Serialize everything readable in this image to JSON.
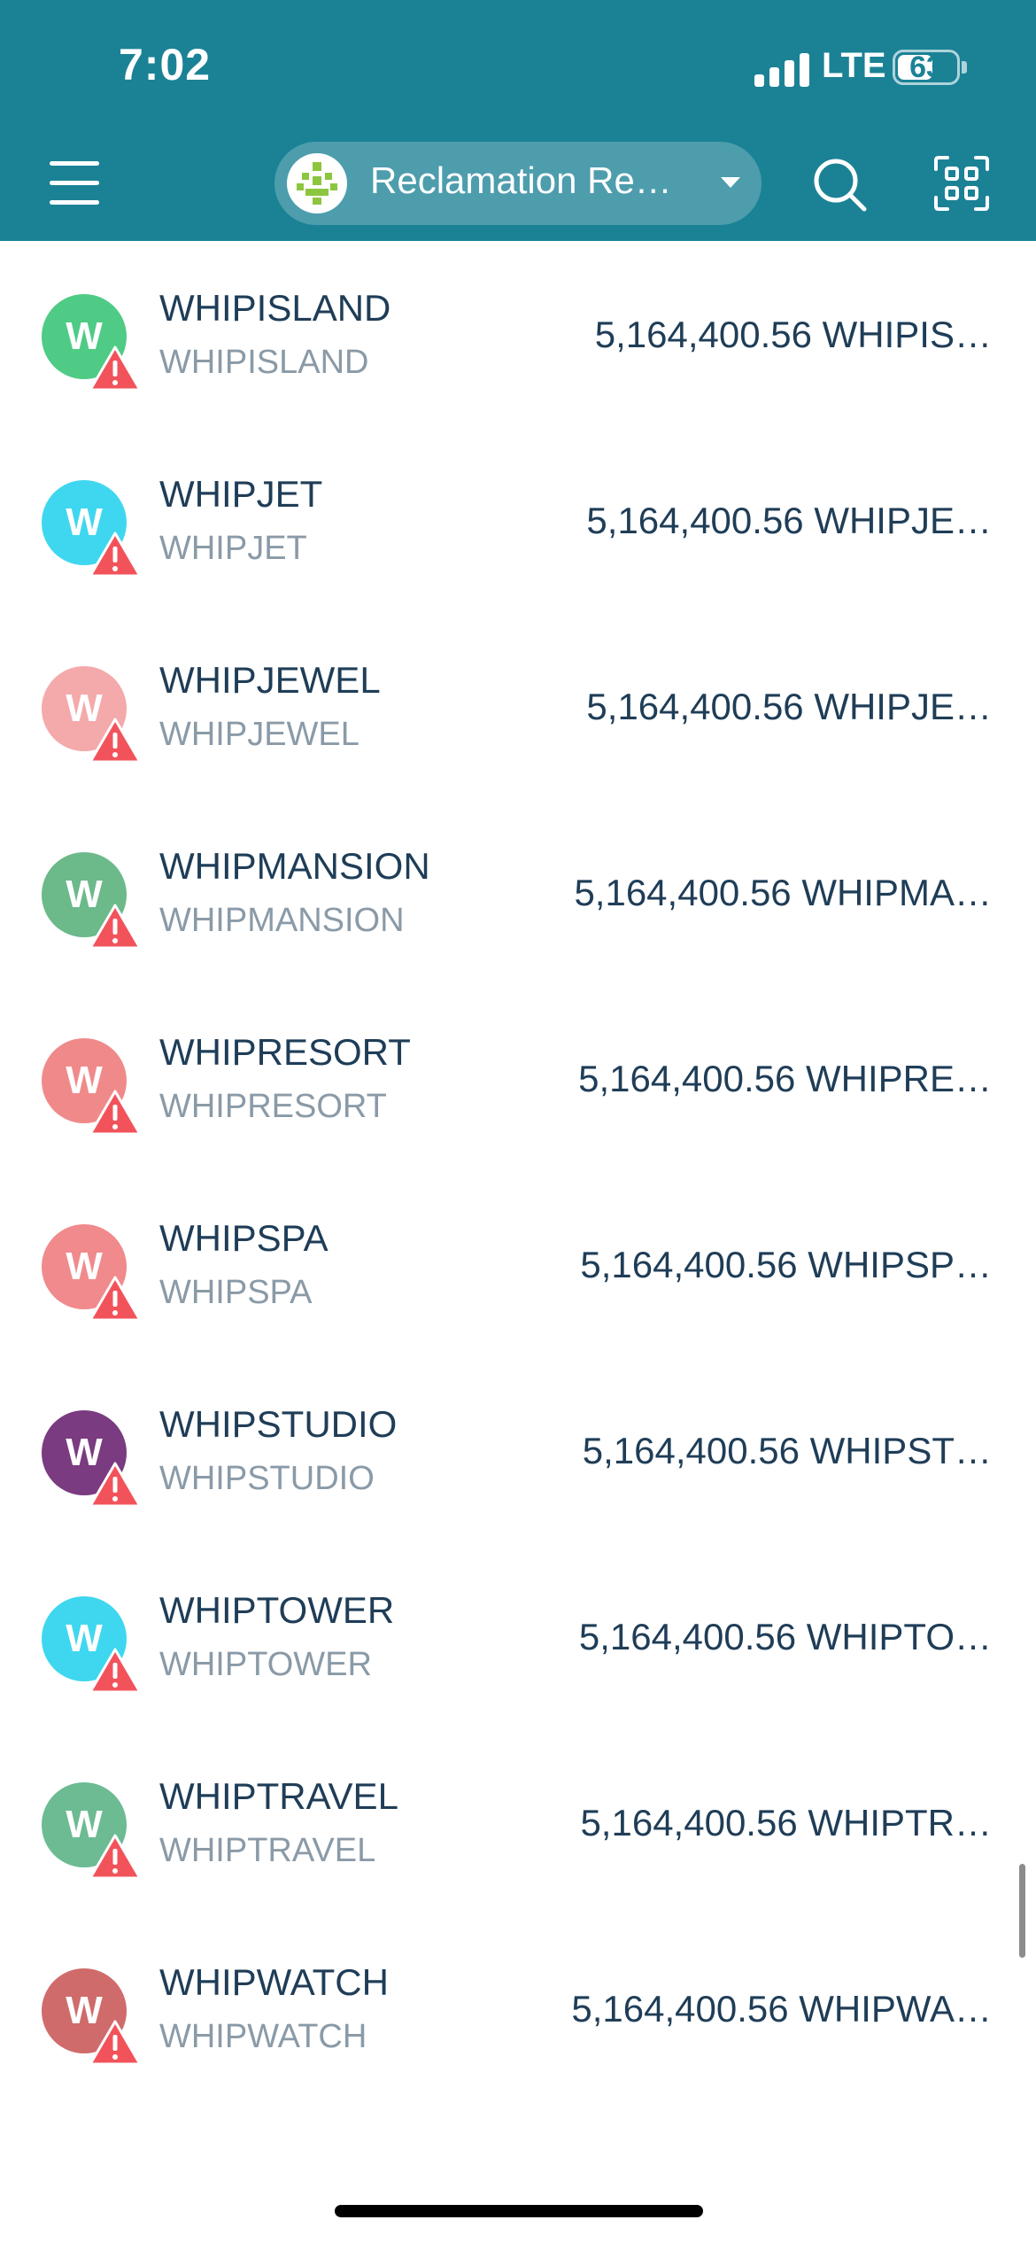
{
  "status_bar": {
    "time": "7:02",
    "network": "LTE",
    "battery": "63",
    "battery_fraction": 0.63
  },
  "header": {
    "menu_icon": "hamburger-menu-icon",
    "network_name": "Reclamation Re…",
    "dropdown_icon": "chevron-down-icon",
    "search_icon": "search-icon",
    "scan_icon": "qr-scan-icon",
    "background_color": "#1b8296"
  },
  "tokens": [
    {
      "initial": "W",
      "name": "WHIPISLAND",
      "symbol": "WHIPISLAND",
      "balance": "5,164,400.56 WHIPIS…",
      "color": "#4fcb86"
    },
    {
      "initial": "W",
      "name": "WHIPJET",
      "symbol": "WHIPJET",
      "balance": "5,164,400.56 WHIPJE…",
      "color": "#3fd7ef"
    },
    {
      "initial": "W",
      "name": "WHIPJEWEL",
      "symbol": "WHIPJEWEL",
      "balance": "5,164,400.56 WHIPJE…",
      "color": "#f4a9ab"
    },
    {
      "initial": "W",
      "name": "WHIPMANSION",
      "symbol": "WHIPMANSION",
      "balance": "5,164,400.56 WHIPMA…",
      "color": "#6cb98a"
    },
    {
      "initial": "W",
      "name": "WHIPRESORT",
      "symbol": "WHIPRESORT",
      "balance": "5,164,400.56 WHIPRE…",
      "color": "#f08a8a"
    },
    {
      "initial": "W",
      "name": "WHIPSPA",
      "symbol": "WHIPSPA",
      "balance": "5,164,400.56 WHIPSP…",
      "color": "#f08a8c"
    },
    {
      "initial": "W",
      "name": "WHIPSTUDIO",
      "symbol": "WHIPSTUDIO",
      "balance": "5,164,400.56 WHIPST…",
      "color": "#7a3b80"
    },
    {
      "initial": "W",
      "name": "WHIPTOWER",
      "symbol": "WHIPTOWER",
      "balance": "5,164,400.56 WHIPTO…",
      "color": "#3fd7ef"
    },
    {
      "initial": "W",
      "name": "WHIPTRAVEL",
      "symbol": "WHIPTRAVEL",
      "balance": "5,164,400.56 WHIPTR…",
      "color": "#6cbb93"
    },
    {
      "initial": "W",
      "name": "WHIPWATCH",
      "symbol": "WHIPWATCH",
      "balance": "5,164,400.56 WHIPWA…",
      "color": "#d06b6b"
    }
  ],
  "warning_icon": "warning-triangle-icon",
  "warning_color": "#f2535b"
}
